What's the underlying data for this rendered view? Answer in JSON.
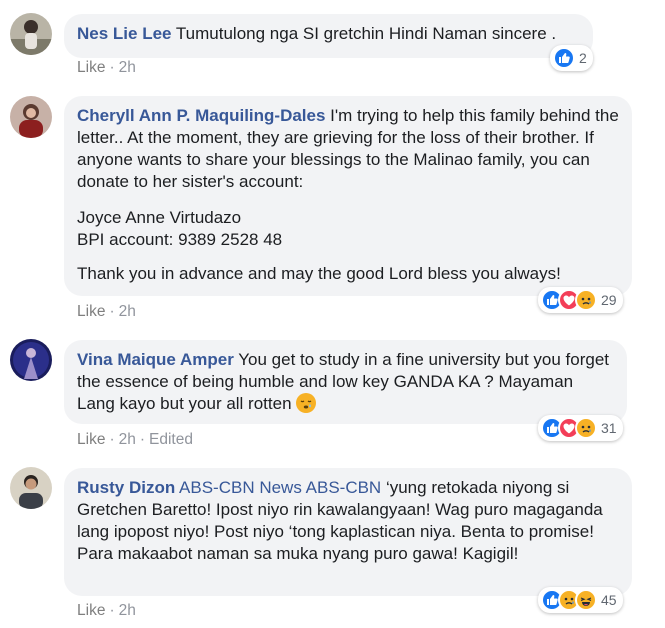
{
  "comments": [
    {
      "author": "Nes Lie Lee",
      "text": "Tumutulong nga SI gretchin Hindi Naman sincere .",
      "like_label": "Like",
      "time": "2h",
      "reaction_count": "2"
    },
    {
      "author": "Cheryll Ann P. Maquiling-Dales",
      "text_lines": [
        "I'm trying to help this family behind the letter.. At the moment, they are grieving for the loss of their brother. If anyone wants to share your blessings to the Malinao family, you can donate to her sister's account:",
        "Joyce Anne Virtudazo",
        "BPI account: 9389 2528 48",
        "Thank you in advance and may the good Lord bless you always!"
      ],
      "like_label": "Like",
      "time": "2h",
      "reaction_count": "29"
    },
    {
      "author": "Vina Maique Amper",
      "text": "You get to study in a fine university but you forget the essence of being humble and low key GANDA KA ? Mayaman Lang kayo but your all rotten",
      "like_label": "Like",
      "time": "2h",
      "edited_label": "Edited",
      "reaction_count": "31"
    },
    {
      "author": "Rusty Dizon",
      "tags": [
        "ABS-CBN News",
        "ABS-CBN"
      ],
      "text": "‘yung retokada niyong si Gretchen Baretto! Ipost niyo rin kawalangyaan! Wag puro magaganda lang ipopost niyo! Post niyo ‘tong kaplastican niya. Benta to promise! Para makaabot naman sa muka nyang puro gawa! Kagigil!",
      "like_label": "Like",
      "time": "2h",
      "reaction_count": "45"
    }
  ],
  "colors": {
    "name": "#385898",
    "bubble": "#f2f3f5",
    "meta": "#90949c",
    "like_reaction": "#1877f2",
    "love_reaction": "#f33e58",
    "sad_reaction": "#f7b125"
  }
}
